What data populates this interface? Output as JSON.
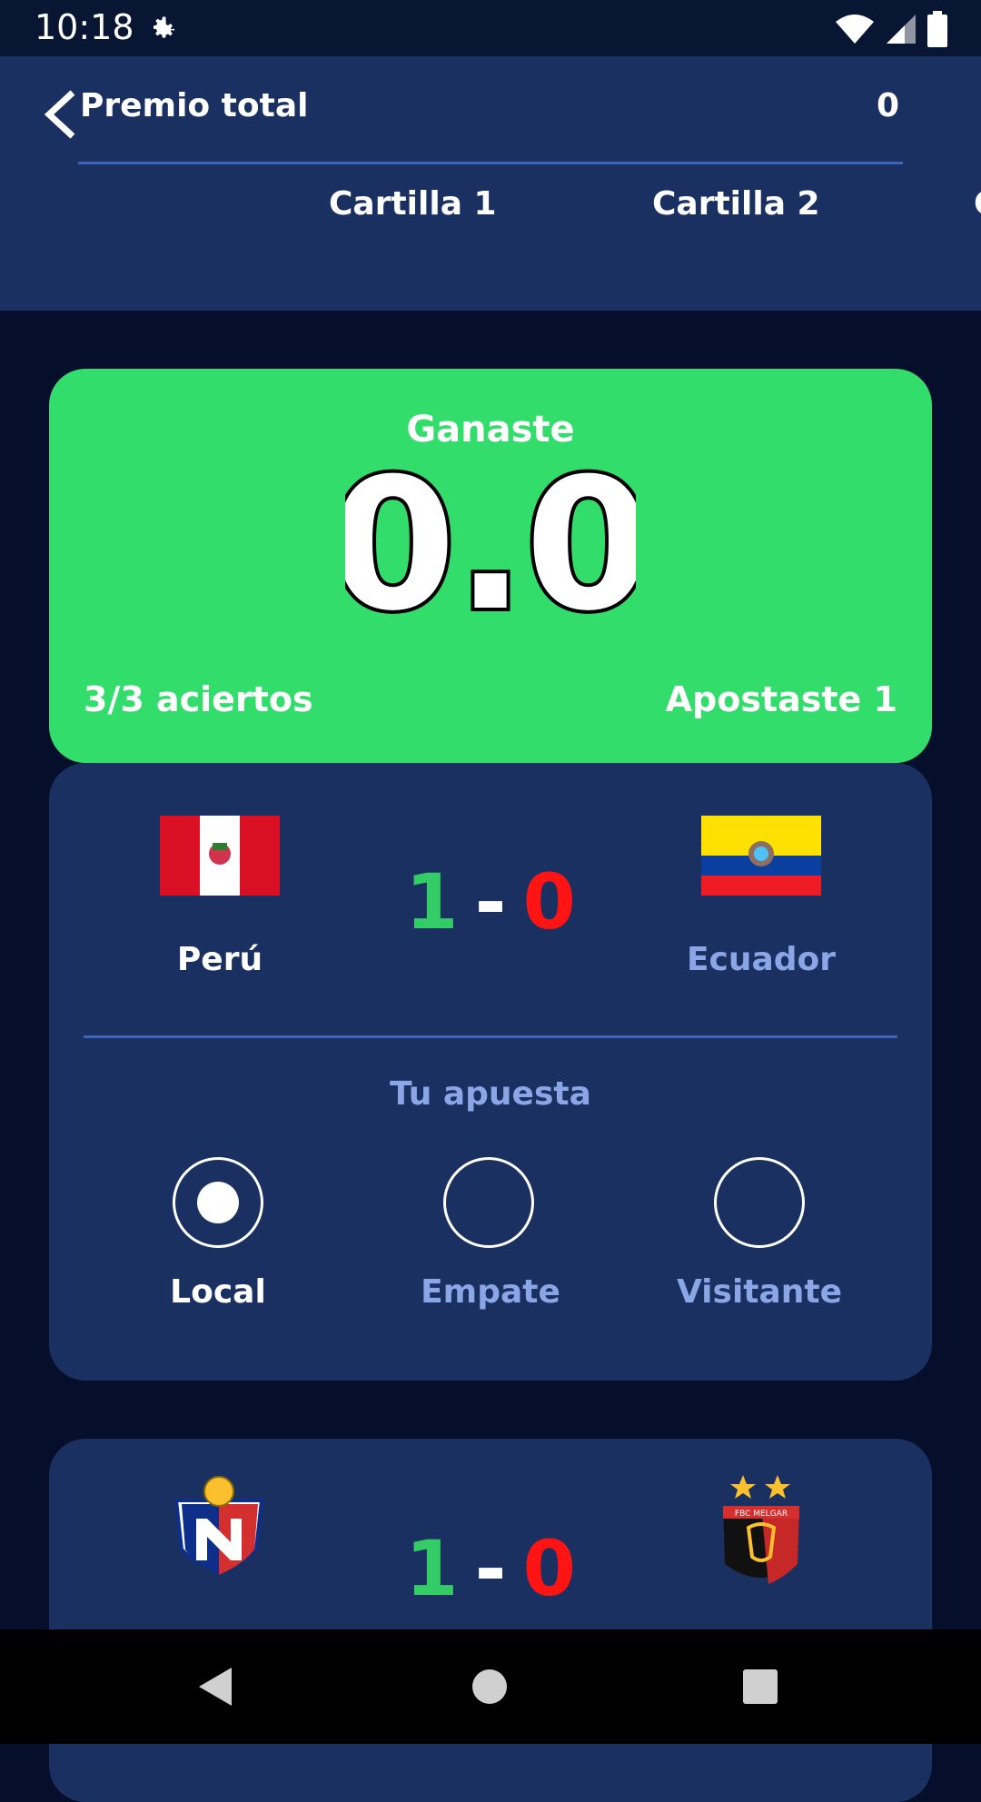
{
  "status": {
    "time": "10:18"
  },
  "header": {
    "title": "Premio total",
    "value": "0"
  },
  "tabs": [
    {
      "label": "Cartilla 1"
    },
    {
      "label": "Cartilla 2"
    },
    {
      "label": "C"
    }
  ],
  "result": {
    "label": "Ganaste",
    "amount": "0.0",
    "aciertos": "3/3 aciertos",
    "apostaste": "Apostaste 1",
    "accent": "#33dd6b"
  },
  "matches": [
    {
      "home": "Perú",
      "away": "Ecuador",
      "home_score": "1",
      "sep": "-",
      "away_score": "0",
      "bet_label": "Tu apuesta",
      "options": [
        {
          "label": "Local",
          "selected": true
        },
        {
          "label": "Empate",
          "selected": false
        },
        {
          "label": "Visitante",
          "selected": false
        }
      ]
    },
    {
      "home": "",
      "away": "",
      "home_score": "1",
      "sep": "-",
      "away_score": "0",
      "away_badge_text": "FBC MELGAR"
    }
  ],
  "colors": {
    "home_score": "#33cc66",
    "away_score": "#ff1414",
    "muted_text": "#8aa6e6",
    "card": "#1a3060"
  }
}
